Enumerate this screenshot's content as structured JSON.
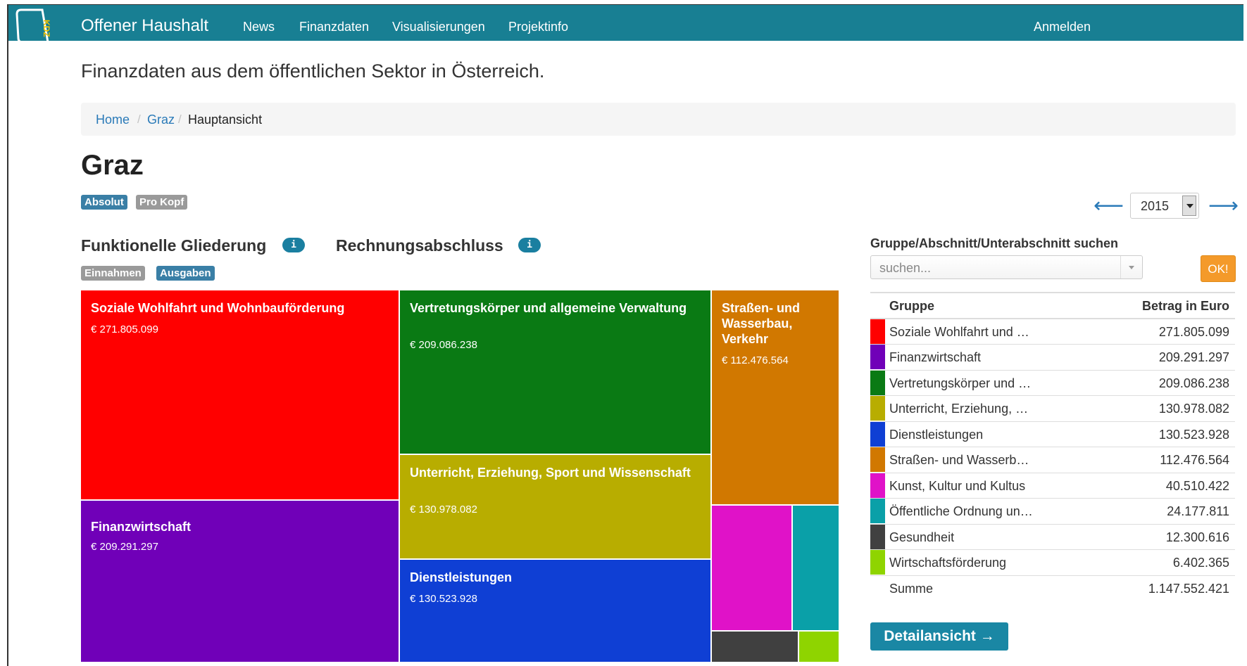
{
  "navbar": {
    "brand": "Offener Haushalt",
    "logo_letters": "KDZ",
    "links": [
      "News",
      "Finanzdaten",
      "Visualisierungen",
      "Projektinfo"
    ],
    "login": "Anmelden",
    "color": "#187f93"
  },
  "tagline": "Finanzdaten aus dem öffentlichen Sektor in Österreich.",
  "breadcrumb": {
    "home": "Home",
    "city": "Graz",
    "current": "Hauptansicht",
    "separator": "/"
  },
  "page_title": "Graz",
  "mode_labels": {
    "absolute": "Absolut",
    "per_capita": "Pro Kopf"
  },
  "year": {
    "selected": "2015",
    "prev": "⟵",
    "next": "⟶"
  },
  "sections": {
    "functional": "Funktionelle Gliederung",
    "accounts": "Rechnungsabschluss",
    "info_icon": "i"
  },
  "flow_labels": {
    "income": "Einnahmen",
    "expenses": "Ausgaben"
  },
  "treemap": [
    {
      "name": "Soziale Wohlfahrt und Wohnbauförderung",
      "amount": "€ 271.805.099",
      "color": "#ff0000"
    },
    {
      "name": "Finanzwirtschaft",
      "amount": "€ 209.291.297",
      "color": "#7000b8"
    },
    {
      "name": "Vertretungskörper und allgemeine Verwaltung",
      "amount": "€ 209.086.238",
      "color": "#0a7a14"
    },
    {
      "name": "Unterricht, Erziehung, Sport und Wissenschaft",
      "amount": "€ 130.978.082",
      "color": "#b8ad00"
    },
    {
      "name": "Dienstleistungen",
      "amount": "€ 130.523.928",
      "color": "#0f3fd4"
    },
    {
      "name": "Straßen- und Wasserbau, Verkehr",
      "amount": "€ 112.476.564",
      "color": "#d17800"
    },
    {
      "name": "",
      "amount": "",
      "color": "#e012c8"
    },
    {
      "name": "",
      "amount": "",
      "color": "#0aa0a8"
    },
    {
      "name": "",
      "amount": "",
      "color": "#404040"
    },
    {
      "name": "",
      "amount": "",
      "color": "#8fd400"
    }
  ],
  "search": {
    "label": "Gruppe/Abschnitt/Unterabschnitt suchen",
    "placeholder": "suchen...",
    "ok": "OK!"
  },
  "table": {
    "headers": [
      "Gruppe",
      "Betrag in Euro"
    ],
    "rows": [
      {
        "group": "Soziale Wohlfahrt und …",
        "amount": "271.805.099",
        "color": "#ff0000"
      },
      {
        "group": "Finanzwirtschaft",
        "amount": "209.291.297",
        "color": "#7000b8"
      },
      {
        "group": "Vertretungskörper und …",
        "amount": "209.086.238",
        "color": "#0a7a14"
      },
      {
        "group": "Unterricht, Erziehung, …",
        "amount": "130.978.082",
        "color": "#b8ad00"
      },
      {
        "group": "Dienstleistungen",
        "amount": "130.523.928",
        "color": "#0f3fd4"
      },
      {
        "group": "Straßen- und Wasserb…",
        "amount": "112.476.564",
        "color": "#d17800"
      },
      {
        "group": "Kunst, Kultur und Kultus",
        "amount": "40.510.422",
        "color": "#e012c8"
      },
      {
        "group": "Öffentliche Ordnung un…",
        "amount": "24.177.811",
        "color": "#0aa0a8"
      },
      {
        "group": "Gesundheit",
        "amount": "12.300.616",
        "color": "#404040"
      },
      {
        "group": "Wirtschaftsförderung",
        "amount": "6.402.365",
        "color": "#8fd400"
      }
    ],
    "sum": {
      "label": "Summe",
      "amount": "1.147.552.421"
    }
  },
  "detail_button": "Detailansicht →"
}
